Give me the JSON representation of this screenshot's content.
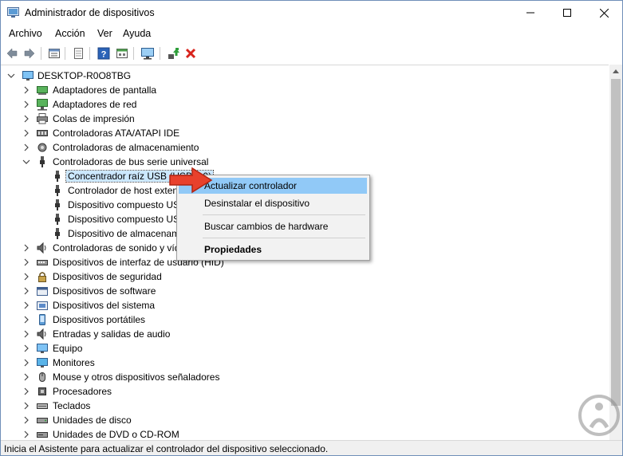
{
  "window": {
    "title": "Administrador de dispositivos"
  },
  "menu": [
    "Archivo",
    "Acción",
    "Ver",
    "Ayuda"
  ],
  "toolbar": {
    "icons": [
      "back-arrow-icon",
      "forward-arrow-icon",
      "properties-list-icon",
      "scan-hardware-icon",
      "help-icon",
      "view-icon",
      "monitor-icon",
      "update-driver-icon",
      "uninstall-x-icon"
    ]
  },
  "tree": {
    "root": "DESKTOP-R0O8TBG",
    "categories": [
      {
        "label": "Adaptadores de pantalla"
      },
      {
        "label": "Adaptadores de red"
      },
      {
        "label": "Colas de impresión"
      },
      {
        "label": "Controladoras ATA/ATAPI IDE"
      },
      {
        "label": "Controladoras de almacenamiento"
      },
      {
        "label": "Controladoras de bus serie universal",
        "expanded": true
      },
      {
        "label": "Concentrador raíz USB (USB 3.0)",
        "child": true,
        "selected": true
      },
      {
        "label": "Controlador de host extensible",
        "child": true
      },
      {
        "label": "Dispositivo compuesto USB",
        "child": true
      },
      {
        "label": "Dispositivo compuesto USB",
        "child": true
      },
      {
        "label": "Dispositivo de almacenamiento",
        "child": true
      },
      {
        "label": "Controladoras de sonido y vídeo"
      },
      {
        "label": "Dispositivos de interfaz de usuario (HID)"
      },
      {
        "label": "Dispositivos de seguridad"
      },
      {
        "label": "Dispositivos de software"
      },
      {
        "label": "Dispositivos del sistema"
      },
      {
        "label": "Dispositivos portátiles"
      },
      {
        "label": "Entradas y salidas de audio"
      },
      {
        "label": "Equipo"
      },
      {
        "label": "Monitores"
      },
      {
        "label": "Mouse y otros dispositivos señaladores"
      },
      {
        "label": "Procesadores"
      },
      {
        "label": "Teclados"
      },
      {
        "label": "Unidades de disco"
      },
      {
        "label": "Unidades de DVD o CD-ROM"
      }
    ]
  },
  "context_menu": {
    "items": [
      {
        "label": "Actualizar controlador",
        "highlighted": true
      },
      {
        "label": "Desinstalar el dispositivo"
      },
      {
        "label": "Buscar cambios de hardware"
      },
      {
        "label": "Propiedades",
        "bold": true
      }
    ]
  },
  "status": {
    "text": "Inicia el Asistente para actualizar el controlador del dispositivo seleccionado."
  },
  "colors": {
    "selection": "#cce8ff",
    "menu_highlight": "#91c9f7",
    "arrow_red": "#e8412c"
  }
}
